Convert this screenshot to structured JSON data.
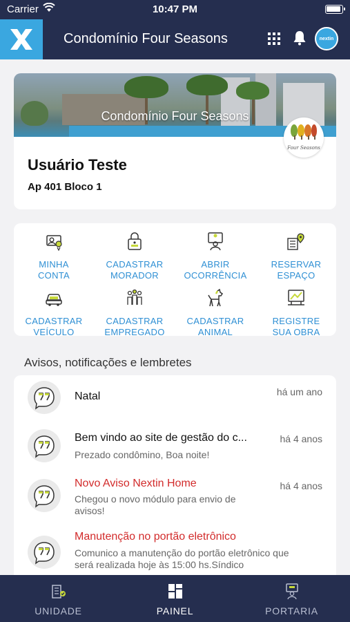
{
  "status_bar": {
    "carrier": "Carrier",
    "time": "10:47 PM"
  },
  "header": {
    "title": "Condomínio Four Seasons",
    "avatar_text": "nextin"
  },
  "profile": {
    "banner_caption": "Condomínio Four Seasons",
    "seal_text": "Four Seasons",
    "user_name": "Usuário Teste",
    "apartment": "Ap 401 Bloco 1"
  },
  "actions": [
    {
      "line1": "MINHA",
      "line2": "CONTA",
      "icon": "user-account-icon"
    },
    {
      "line1": "CADASTRAR",
      "line2": "MORADOR",
      "icon": "register-resident-icon"
    },
    {
      "line1": "ABRIR",
      "line2": "OCORRÊNCIA",
      "icon": "report-incident-icon"
    },
    {
      "line1": "RESERVAR",
      "line2": "ESPAÇO",
      "icon": "reserve-space-icon"
    },
    {
      "line1": "CADASTRAR",
      "line2": "VEÍCULO",
      "icon": "car-icon"
    },
    {
      "line1": "CADASTRAR",
      "line2": "EMPREGADO",
      "icon": "employees-icon"
    },
    {
      "line1": "CADASTRAR",
      "line2": "ANIMAL",
      "icon": "dog-icon"
    },
    {
      "line1": "REGISTRE",
      "line2": "SUA OBRA",
      "icon": "construction-icon"
    }
  ],
  "notices_section_title": "Avisos, notificações e lembretes",
  "notices": [
    {
      "title": "Natal",
      "time": "há um ano",
      "body": "",
      "highlight": false
    },
    {
      "title": "Bem vindo ao site de gestão do c...",
      "time": "há 4 anos",
      "body": "Prezado condômino, Boa noite!",
      "highlight": false
    },
    {
      "title": "Novo Aviso Nextin Home",
      "time": "há 4 anos",
      "body": "Chegou o novo módulo para envio de avisos!",
      "highlight": true
    },
    {
      "title": "Manutenção no portão eletrônico",
      "time": "",
      "body": "Comunico a manutenção do portão eletrônico que será realizada hoje às 15:00 hs.Síndico",
      "highlight": true
    }
  ],
  "tabs": [
    {
      "label": "UNIDADE",
      "icon": "unit-icon",
      "active": false
    },
    {
      "label": "PAINEL",
      "icon": "dashboard-icon",
      "active": true
    },
    {
      "label": "PORTARIA",
      "icon": "concierge-icon",
      "active": false
    }
  ],
  "colors": {
    "navy": "#252e4f",
    "accent_blue": "#2e8fd4",
    "logo_blue": "#3aa7e0",
    "alert_red": "#d22b2b",
    "icon_lime": "#c7d93a"
  }
}
